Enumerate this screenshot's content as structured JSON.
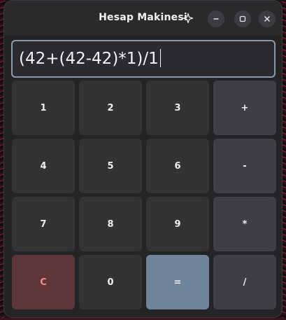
{
  "window": {
    "title": "Hesap Makinesi",
    "icons": {
      "pin": "pin-icon",
      "minimize": "minimize-icon",
      "maximize": "maximize-icon",
      "close": "close-icon"
    }
  },
  "display": {
    "expression": "(42+(42-42)*1)/1"
  },
  "keypad": {
    "rows": [
      [
        "1",
        "2",
        "3",
        "+"
      ],
      [
        "4",
        "5",
        "6",
        "-"
      ],
      [
        "7",
        "8",
        "9",
        "*"
      ],
      [
        "C",
        "0",
        "=",
        "/"
      ]
    ]
  },
  "colors": {
    "window_bg": "#242427",
    "key_bg": "#333336",
    "operator_bg": "#3f3f43",
    "clear_bg": "#5c3638",
    "clear_text": "#ff8a84",
    "equals_bg": "#6f8499",
    "display_border": "#8a98a6"
  }
}
